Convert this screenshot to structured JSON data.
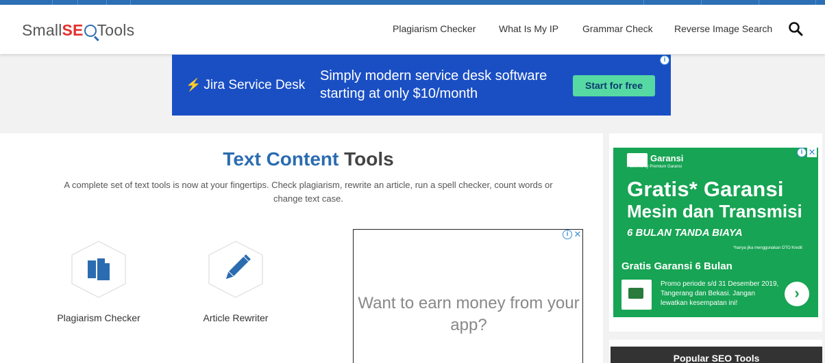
{
  "header": {
    "logo": {
      "prefix": "Small",
      "seo": "SE",
      "suffix": "Tools"
    },
    "nav": [
      {
        "label": "Plagiarism Checker"
      },
      {
        "label": "What Is My IP"
      },
      {
        "label": "Grammar Check"
      },
      {
        "label": "Reverse Image Search"
      }
    ],
    "search_icon": "search-icon"
  },
  "ad_top": {
    "brand": "Jira Service Desk",
    "headline": "Simply modern service desk software starting at only $10/month",
    "cta": "Start for free"
  },
  "main": {
    "title_blue": "Text Content",
    "title_dark": "Tools",
    "subtitle": "A complete set of text tools is now at your fingertips. Check plagiarism, rewrite an article, run a spell checker, count words or change text case.",
    "tools": [
      {
        "label": "Plagiarism Checker",
        "icon": "documents-icon"
      },
      {
        "label": "Article Rewriter",
        "icon": "pencil-icon"
      }
    ]
  },
  "ad_mid": {
    "text": "Want to earn money from your app?"
  },
  "ad_side": {
    "brand": "Garansi",
    "powered": "Powered by Premium Garansi",
    "big_line1": "Gratis* Garansi",
    "big_line2": "Mesin dan Transmisi",
    "promo": "6 BULAN TANDA BIAYA",
    "note": "*hanya jika menggunakan OTO Kredit",
    "sub": "Gratis Garansi 6 Bulan",
    "desc": "Promo periode s/d 31 Desember 2019, Tangerang dan Bekasi. Jangan lewatkan kesempatan ini!",
    "arrow": "›"
  },
  "sidebar": {
    "popular_title": "Popular SEO Tools"
  },
  "colors": {
    "brand_blue": "#2b6cb0",
    "seo_red": "#e2302d",
    "ad_green": "#17a454",
    "jira_blue": "#1a4fc4"
  }
}
